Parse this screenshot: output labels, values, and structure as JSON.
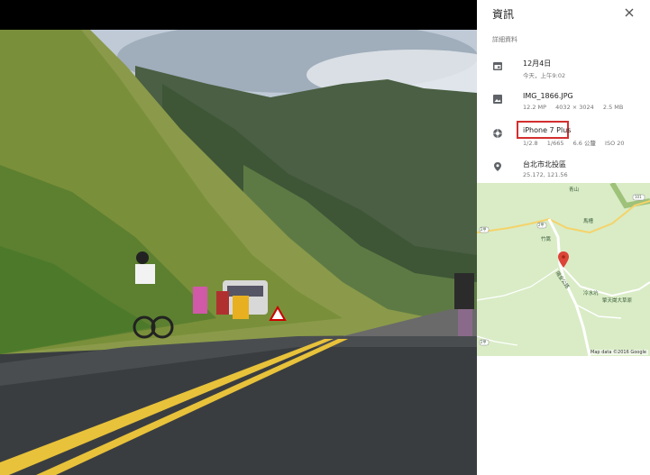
{
  "panel": {
    "title": "資訊",
    "section_label": "詳細資料",
    "date": {
      "main": "12月4日",
      "sub": "今天，上午9:02"
    },
    "file": {
      "name": "IMG_1866.JPG",
      "mp": "12.2 MP",
      "dims": "4032 × 3024",
      "size": "2.5 MB"
    },
    "camera": {
      "model": "iPhone 7 Plus",
      "aperture": "1/2.8",
      "shutter": "1/665",
      "focal": "6.6 公釐",
      "iso": "ISO 20"
    },
    "location": {
      "name": "台北市北投區",
      "coords": "25.172, 121.56"
    }
  },
  "map": {
    "credit": "Map data ©2016 Google",
    "labels": [
      "青山",
      "竹篙",
      "馬槽",
      "陽金公路",
      "擎天崗大草原",
      "冷水坑"
    ],
    "shields": [
      "2甲",
      "101",
      "2甲",
      "2甲"
    ]
  },
  "colors": {
    "highlight": "#d32f2f",
    "pin": "#db4437"
  }
}
